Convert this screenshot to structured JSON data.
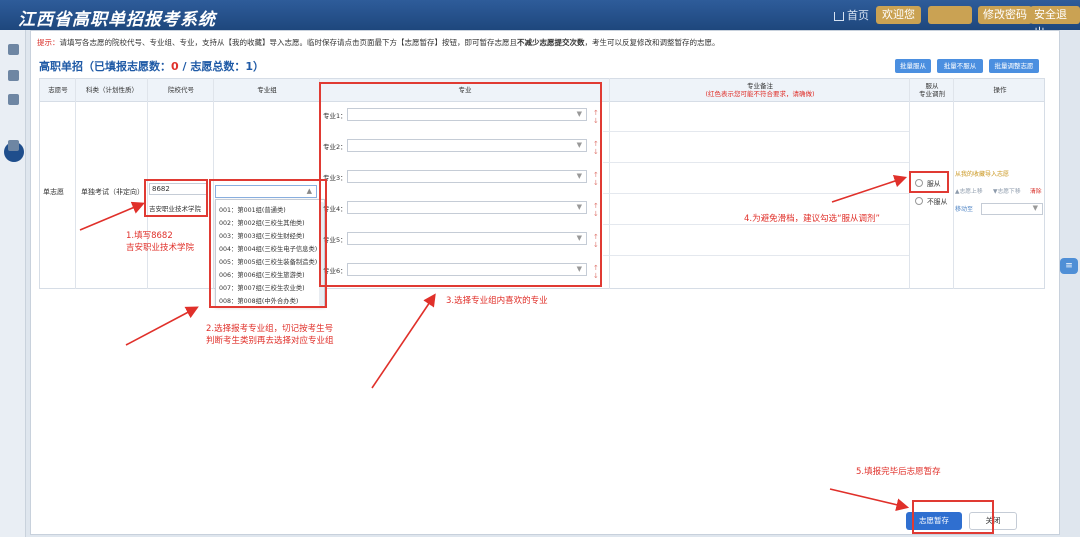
{
  "header": {
    "title": "江西省高职单招报考系统",
    "home": "首页",
    "welcome": "欢迎您",
    "change_pwd": "修改密码",
    "logout": "安全退出"
  },
  "tip": {
    "prefix": "提示：",
    "text": "请填写各志愿的院校代号、专业组、专业，支持从【我的收藏】导入志愿。临时保存请点击页面最下方【志愿暂存】按钮，即可暂存志愿且",
    "emphasis": "不减少志愿提交次数",
    "suffix": "，考生可以反复修改和调整暂存的志愿。"
  },
  "section": {
    "title_prefix": "高职单招（已填报志愿数：",
    "filled": "0",
    "title_mid": " / 志愿总数：",
    "total": "1",
    "title_suffix": "）"
  },
  "top_buttons": [
    "批量服从",
    "批量不服从",
    "批量调整志愿"
  ],
  "table": {
    "headers": {
      "zyh": "志愿号",
      "kl": "科类（计划性质）",
      "yxdh": "院校代号",
      "zyz": "专业组",
      "zy": "专业",
      "zybz": "专业备注",
      "zybz_sub": "(红色表示您可能不符合要求，请确做)",
      "fc": "服从\n专业调剂",
      "cz": "操作"
    },
    "row": {
      "zyh": "单志愿",
      "kl": "单独考试（非定向）",
      "school_code": "8682",
      "school_name": "吉安职业技术学院"
    }
  },
  "group_options": [
    "001：第001组(普通类)",
    "002：第002组(三校生其他类)",
    "003：第003组(三校生财经类)",
    "004：第004组(三校生电子信息类)",
    "005：第005组(三校生装备制造类)",
    "006：第006组(三校生旅游类)",
    "007：第007组(三校生农业类)",
    "008：第008组(中外合办类)"
  ],
  "majors": [
    "专业1：",
    "专业2：",
    "专业3：",
    "专业4：",
    "专业5：",
    "专业6："
  ],
  "major_updown": "↑ ↓",
  "adjust": {
    "obey": "服从",
    "not_obey": "不服从"
  },
  "ops": {
    "import": "从我的收藏导入志愿",
    "move_up": "▲志愿上移",
    "move_down": "▼志愿下移",
    "clear": "清除",
    "move_to": "移动至"
  },
  "annotations": {
    "a1_line1": "1.填写8682",
    "a1_line2": "吉安职业技术学院",
    "a2_line1": "2.选择报考专业组，切记按考生号",
    "a2_line2": "判断考生类别再去选择对应专业组",
    "a3": "3.选择专业组内喜欢的专业",
    "a4": "4.为避免滑档，建议勾选“服从调剂”",
    "a5": "5.填报完毕后志愿暂存"
  },
  "buttons": {
    "save": "志愿暂存",
    "close": "关闭"
  },
  "colors": {
    "header": "#1e477d",
    "accent": "#2f6fd0",
    "annotation": "#e0302a",
    "nav_gold": "#caa253"
  }
}
